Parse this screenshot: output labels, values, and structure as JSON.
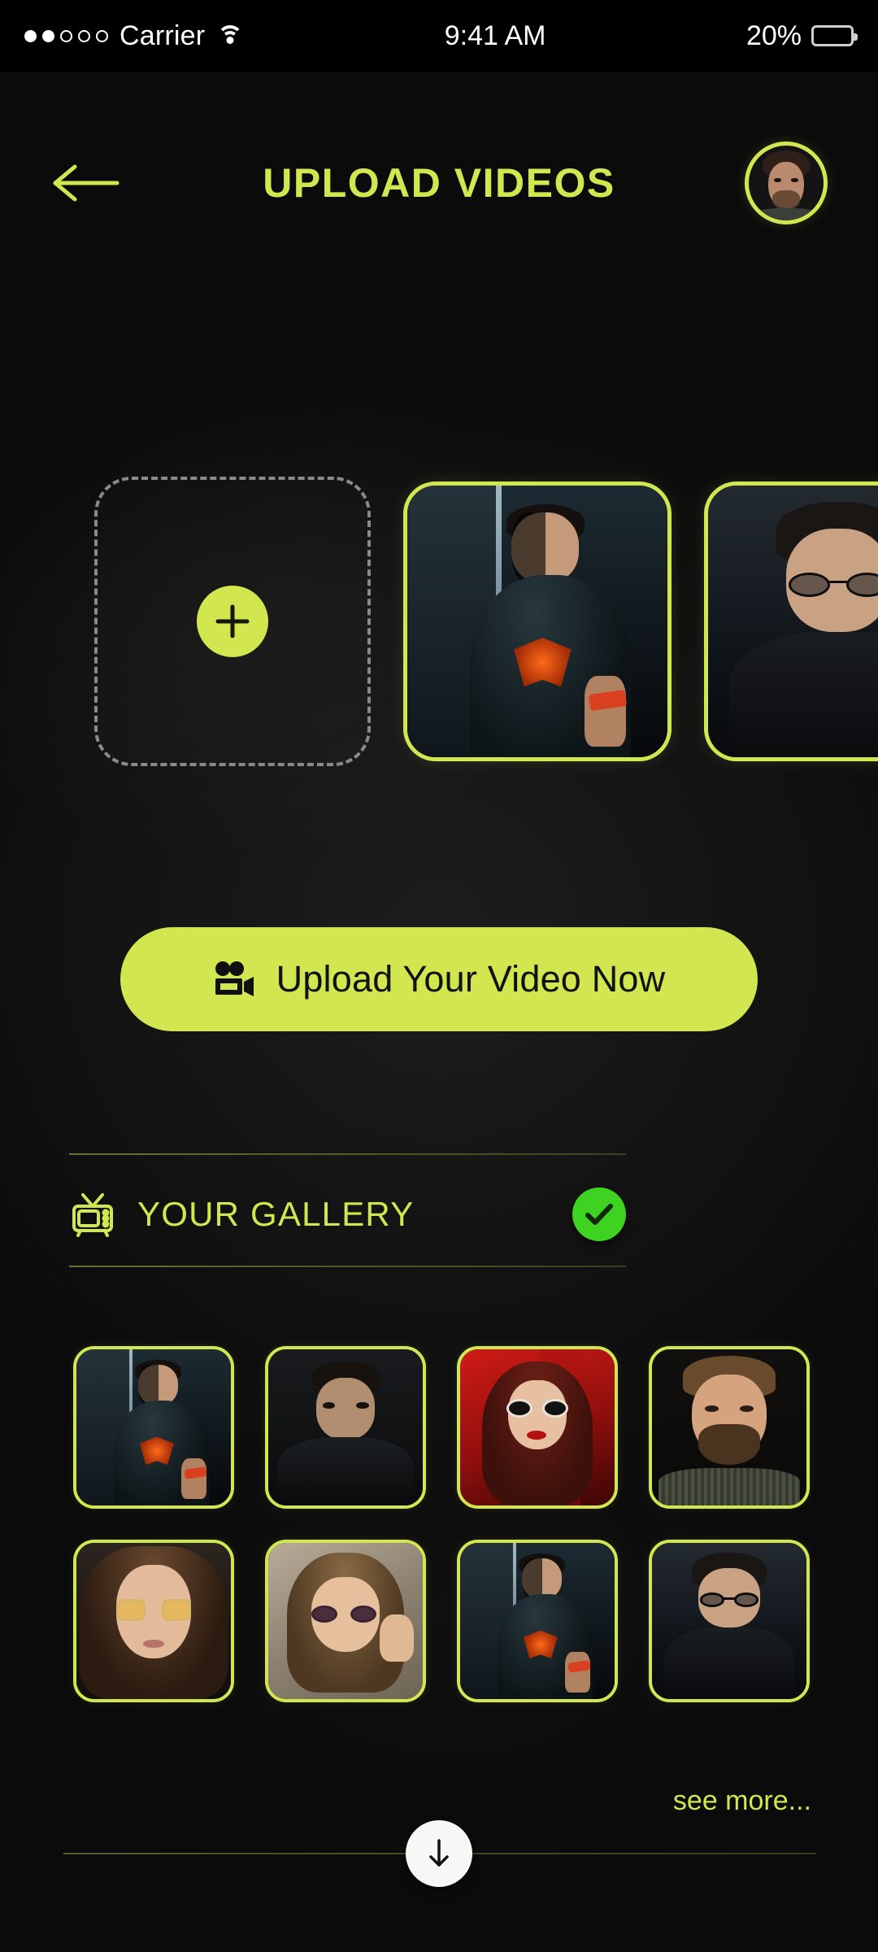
{
  "status_bar": {
    "signal_dots_filled": 2,
    "signal_dots_total": 5,
    "carrier": "Carrier",
    "wifi_icon": "wifi-icon",
    "time": "9:41 AM",
    "battery_percent": "20%",
    "battery_level": 20,
    "battery_icon": "battery-icon"
  },
  "header": {
    "back_icon": "arrow-left-icon",
    "title": "UPLOAD VIDEOS",
    "avatar_alt": "user-avatar"
  },
  "carousel": {
    "add_card": {
      "icon": "plus-icon",
      "label": ""
    },
    "items": [
      {
        "alt": "video-thumbnail-superman-tee",
        "scene": "hero"
      },
      {
        "alt": "video-thumbnail-man-glasses-jacket",
        "scene": "glasses"
      }
    ]
  },
  "upload": {
    "icon": "video-camera-icon",
    "label": "Upload Your Video Now"
  },
  "gallery": {
    "icon": "tv-icon",
    "title": "YOUR GALLERY",
    "status_icon": "check-circle-icon",
    "status_color": "#3ed221",
    "items": [
      {
        "alt": "gallery-thumbnail-1",
        "scene": "hero"
      },
      {
        "alt": "gallery-thumbnail-2",
        "scene": "dark"
      },
      {
        "alt": "gallery-thumbnail-3",
        "scene": "redlady"
      },
      {
        "alt": "gallery-thumbnail-4",
        "scene": "beard"
      },
      {
        "alt": "gallery-thumbnail-5",
        "scene": "gglasses"
      },
      {
        "alt": "gallery-thumbnail-6",
        "scene": "wall"
      },
      {
        "alt": "gallery-thumbnail-7",
        "scene": "hero"
      },
      {
        "alt": "gallery-thumbnail-8",
        "scene": "glasses"
      }
    ],
    "see_more": "see more..."
  },
  "footer": {
    "scroll_icon": "arrow-down-icon"
  },
  "colors": {
    "accent_lime": "#d2e64f",
    "success_green": "#3ed221",
    "background": "#0b0b0b",
    "text_on_accent": "#111111"
  }
}
